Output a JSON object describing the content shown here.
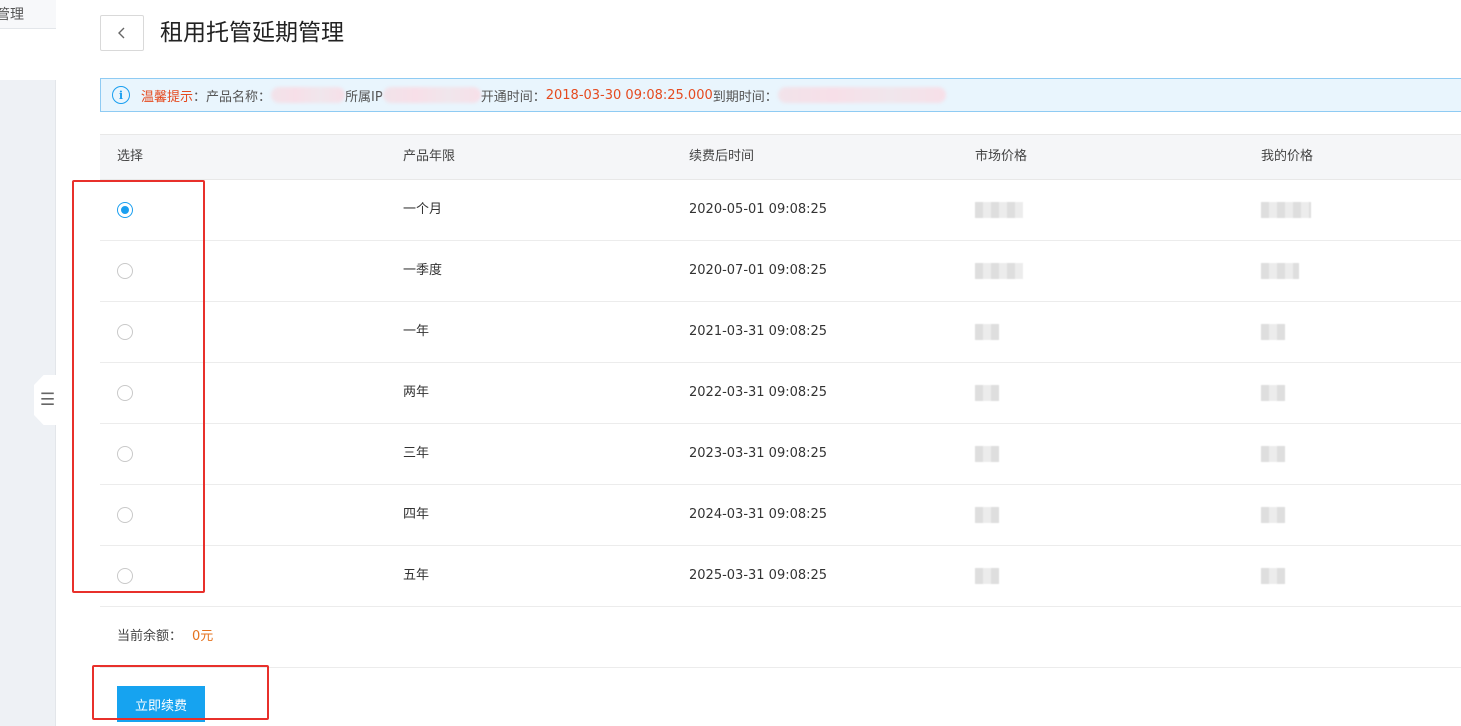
{
  "sidebar": {
    "top_item_label": "管理",
    "toggle_icon": "menu-collapse-icon"
  },
  "header": {
    "title": "租用托管延期管理",
    "back_icon": "chevron-left-icon"
  },
  "tip": {
    "icon": "info-icon",
    "label": "温馨提示",
    "product_name_label": "：产品名称：",
    "ip_label": "所属IP",
    "open_time_label": "开通时间：",
    "open_time_value": "2018-03-30 09:08:25.000",
    "expire_label": " 到期时间："
  },
  "table": {
    "headers": [
      "选择",
      "产品年限",
      "续费后时间",
      "市场价格",
      "我的价格"
    ],
    "rows": [
      {
        "selected": true,
        "duration": "一个月",
        "renew_time": "2020-05-01 09:08:25"
      },
      {
        "selected": false,
        "duration": "一季度",
        "renew_time": "2020-07-01 09:08:25"
      },
      {
        "selected": false,
        "duration": "一年",
        "renew_time": "2021-03-31 09:08:25"
      },
      {
        "selected": false,
        "duration": "两年",
        "renew_time": "2022-03-31 09:08:25"
      },
      {
        "selected": false,
        "duration": "三年",
        "renew_time": "2023-03-31 09:08:25"
      },
      {
        "selected": false,
        "duration": "四年",
        "renew_time": "2024-03-31 09:08:25"
      },
      {
        "selected": false,
        "duration": "五年",
        "renew_time": "2025-03-31 09:08:25"
      }
    ]
  },
  "balance": {
    "label": "当前余额：",
    "value": "0元"
  },
  "actions": {
    "renew_label": "立即续费"
  },
  "colors": {
    "accent": "#16a3f0",
    "warning_text": "#e54a1f",
    "annotation": "#e8302b"
  }
}
